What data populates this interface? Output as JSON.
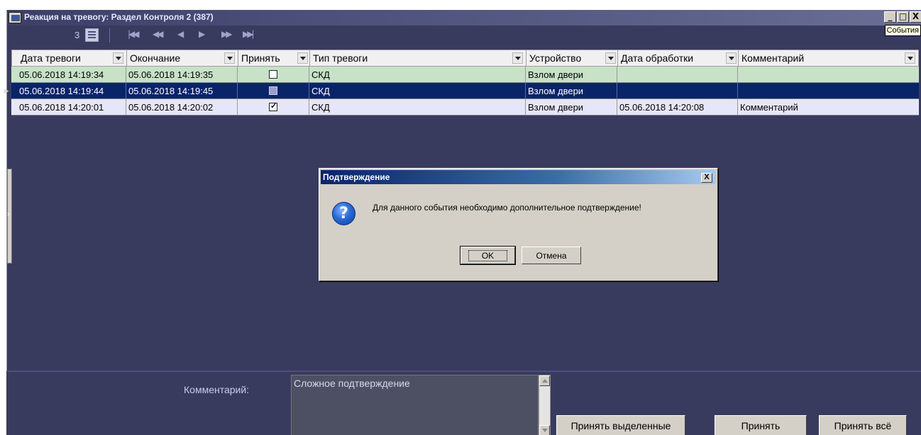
{
  "window": {
    "title": "Реакция на тревогу: Раздел  Контроля 2 (387)",
    "icon": "app-window-icon",
    "controls": [
      "_",
      "□",
      "X"
    ]
  },
  "tooltip": "События",
  "navbar": {
    "page_count": "3",
    "buttons": [
      "first-page",
      "prev-fast",
      "prev",
      "next",
      "next-fast",
      "last-page"
    ]
  },
  "table": {
    "columns": [
      "Дата тревоги",
      "Окончание",
      "Принять",
      "Тип тревоги",
      "Устройство",
      "Дата обработки",
      "Комментарий"
    ],
    "rows": [
      {
        "date": "05.06.2018 14:19:34",
        "end": "05.06.2018 14:19:35",
        "accepted": false,
        "type": "СКД",
        "device": "Взлом двери",
        "processed": "",
        "comment": ""
      },
      {
        "date": "05.06.2018 14:19:44",
        "end": "05.06.2018 14:19:45",
        "accepted": false,
        "type": "СКД",
        "device": "Взлом двери",
        "processed": "",
        "comment": ""
      },
      {
        "date": "05.06.2018 14:20:01",
        "end": "05.06.2018 14:20:02",
        "accepted": true,
        "type": "СКД",
        "device": "Взлом двери",
        "processed": "05.06.2018 14:20:08",
        "comment": "Комментарий"
      }
    ],
    "selected_row": 2
  },
  "dialog": {
    "title": "Подтверждение",
    "message": "Для данного события необходимо дополнительное подтверждение!",
    "ok_label": "OK",
    "cancel_label": "Отмена",
    "close_label": "X"
  },
  "footer": {
    "comment_label": "Комментарий:",
    "comment_value": "Сложное подтверждение",
    "accept_selected_label": "Принять выделенные",
    "accept_label": "Принять",
    "accept_all_label": "Принять всё"
  },
  "colors": {
    "background": "#383b5e",
    "row_green": "#c7e2c7",
    "row_selected": "#0a246a",
    "row_lavender": "#e6e6fa",
    "dialog_face": "#d4d0c8"
  }
}
